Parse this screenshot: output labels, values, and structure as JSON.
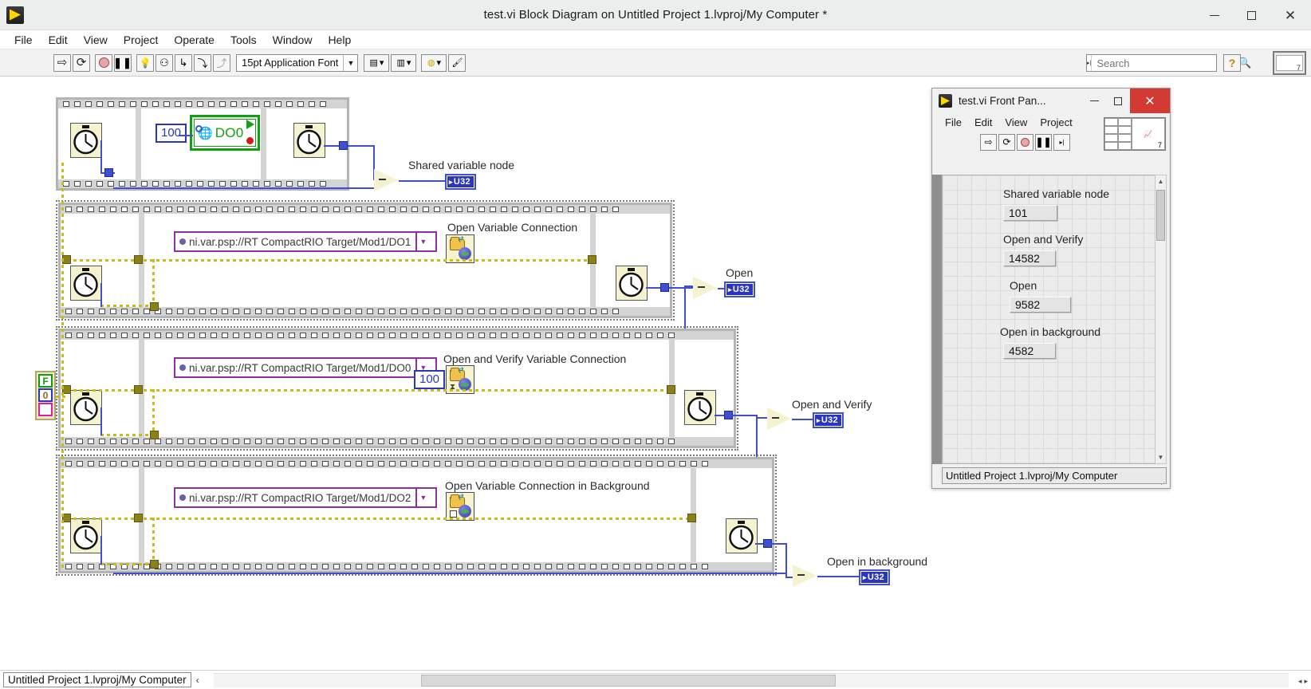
{
  "window": {
    "title": "test.vi Block Diagram on Untitled Project 1.lvproj/My Computer *",
    "app_icon": "labview-icon",
    "minimize": "—",
    "maximize": "▢",
    "close": "✕"
  },
  "menubar": {
    "items": [
      "File",
      "Edit",
      "View",
      "Project",
      "Operate",
      "Tools",
      "Window",
      "Help"
    ]
  },
  "toolbar": {
    "buttons": [
      {
        "name": "run-button",
        "glyph": "⇨"
      },
      {
        "name": "run-continuously-button",
        "glyph": "⟳"
      },
      {
        "name": "abort-execution-button",
        "glyph": "●"
      },
      {
        "name": "pause-button",
        "glyph": "❚❚"
      },
      {
        "name": "highlight-execution-button",
        "glyph": "💡"
      },
      {
        "name": "retain-wire-values-button",
        "glyph": "⚇"
      },
      {
        "name": "step-into-button",
        "glyph": "↳"
      },
      {
        "name": "step-over-button",
        "glyph": "⤵"
      },
      {
        "name": "step-out-button",
        "glyph": "⤴"
      }
    ],
    "font_selector": "15pt Application Font",
    "align_objects": "align-objects-dropdown",
    "distribute_objects": "distribute-objects-dropdown",
    "reorder": "reorder-dropdown",
    "clean_up_diagram": "clean-up-diagram-button",
    "search_placeholder": "Search",
    "help_label": "?",
    "connector_pane_terminals": "7"
  },
  "diagram": {
    "sequences": [
      {
        "name": "shared-variable-node-sequence",
        "frames": 3,
        "label": "Shared variable node",
        "constant": "100",
        "variable_node_name": "DO0",
        "output_label": "Shared variable node",
        "output_type": "U32"
      },
      {
        "name": "open-variable-connection-sequence",
        "frames": 2,
        "psp_path": "ni.var.psp://RT CompactRIO Target/Mod1/DO1",
        "node_label": "Open Variable Connection",
        "output_label": "Open",
        "output_type": "U32"
      },
      {
        "name": "open-and-verify-sequence",
        "frames": 2,
        "psp_path": "ni.var.psp://RT CompactRIO Target/Mod1/DO0",
        "node_label": "Open and Verify Variable Connection",
        "timeout_constant": "100",
        "output_label": "Open and Verify",
        "output_type": "U32"
      },
      {
        "name": "open-in-background-sequence",
        "frames": 2,
        "psp_path": "ni.var.psp://RT CompactRIO Target/Mod1/DO2",
        "node_label": "Open Variable Connection in Background",
        "output_label": "Open in background",
        "output_type": "U32"
      }
    ],
    "error_cluster": {
      "status": "F",
      "code": "0",
      "source": ""
    }
  },
  "front_panel": {
    "title": "test.vi Front Pan...",
    "minimize": "—",
    "maximize": "▢",
    "close": "✕",
    "menu_items": [
      "File",
      "Edit",
      "View",
      "Project"
    ],
    "toolbar_buttons": [
      {
        "name": "fp-run-button",
        "glyph": "⇨"
      },
      {
        "name": "fp-run-continuously-button",
        "glyph": "⟳"
      },
      {
        "name": "fp-abort-button",
        "glyph": "●"
      },
      {
        "name": "fp-pause-button",
        "glyph": "❚❚"
      },
      {
        "name": "fp-more-button",
        "glyph": "▸"
      }
    ],
    "connector_pane_terminals": "7",
    "indicators": [
      {
        "label": "Shared variable node",
        "value": "101"
      },
      {
        "label": "Open and Verify",
        "value": "14582"
      },
      {
        "label": "Open",
        "value": "9582"
      },
      {
        "label": "Open in background",
        "value": "4582"
      }
    ],
    "status_text": "Untitled Project 1.lvproj/My Computer",
    "scroll_up": "▲",
    "scroll_down": "▼"
  },
  "statusbar": {
    "path": "Untitled Project 1.lvproj/My Computer",
    "resize_marker": "‹",
    "scroll_left": "◂",
    "scroll_right": "▸"
  },
  "colors": {
    "wire_blue": "#3f4fd0",
    "error_wire": "#c9bd1a",
    "shared_variable_green": "#12a012",
    "psp_purple": "#8d2f9e",
    "node_yellow": "#f5f2cf",
    "structure_gray": "#d4d4d4"
  }
}
